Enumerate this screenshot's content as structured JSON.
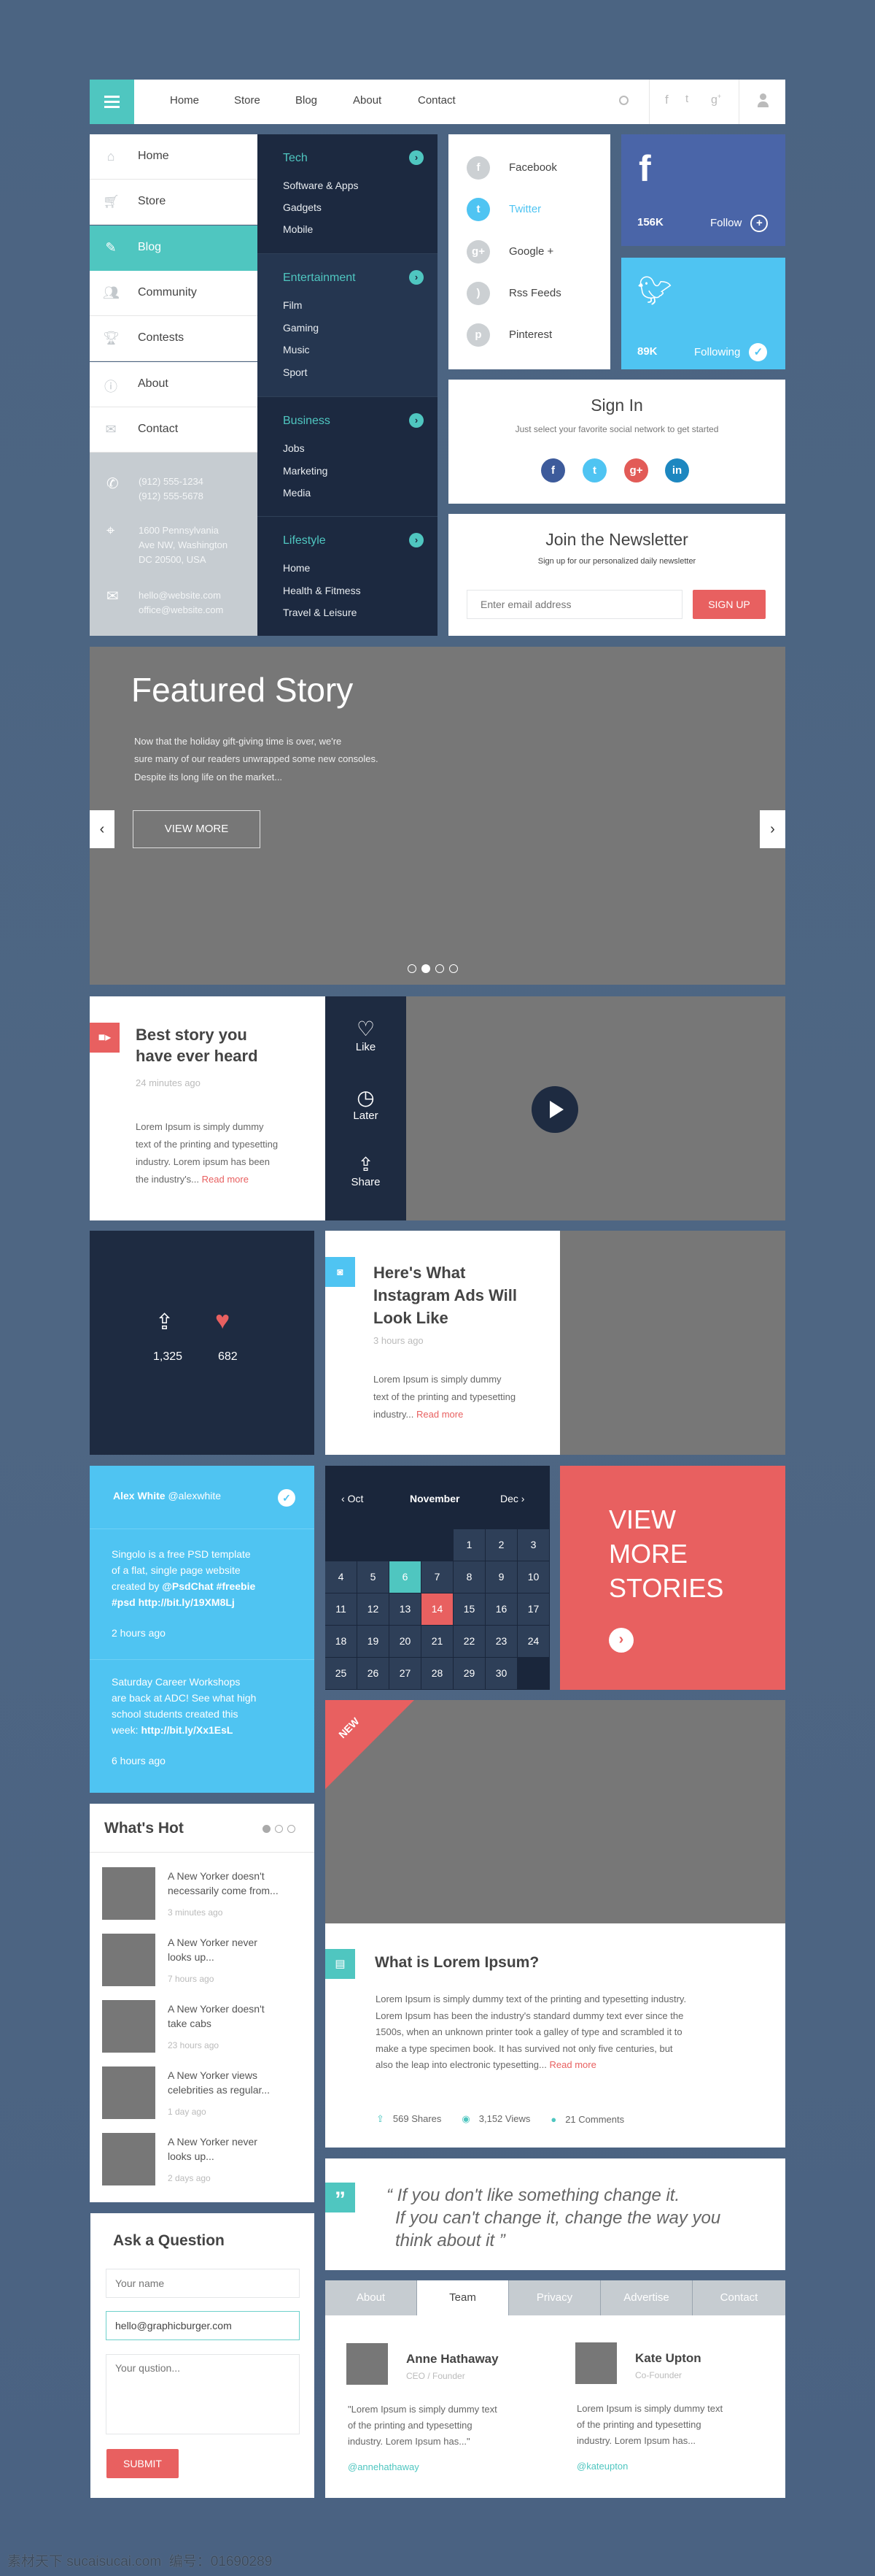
{
  "colors": {
    "teal": "#4fc6c0",
    "dark": "#1e2b41",
    "facebook": "#4a65a8",
    "twitter": "#4fc4f2",
    "red": "#e86060",
    "gray": "#777777"
  },
  "topnav": {
    "menu_icon": "hamburger-icon",
    "items": [
      "Home",
      "Store",
      "Blog",
      "About",
      "Contact"
    ],
    "active": "Blog"
  },
  "sidebar": {
    "items": [
      {
        "label": "Home",
        "icon": "home-icon"
      },
      {
        "label": "Store",
        "icon": "cart-icon"
      },
      {
        "label": "Blog",
        "icon": "edit-icon",
        "active": true
      },
      {
        "label": "Community",
        "icon": "people-icon"
      },
      {
        "label": "Contests",
        "icon": "trophy-icon"
      },
      {
        "label": "About",
        "icon": "info-icon"
      },
      {
        "label": "Contact",
        "icon": "mail-icon"
      }
    ],
    "phone1": "(912) 555-1234",
    "phone2": "(912) 555-5678",
    "address1": "1600 Pennsylvania",
    "address2": "Ave NW, Washington",
    "address3": "DC 20500, USA",
    "email1": "hello@website.com",
    "email2": "office@website.com"
  },
  "megamenu": [
    {
      "title": "Tech",
      "items": [
        "Software & Apps",
        "Gadgets",
        "Mobile"
      ]
    },
    {
      "title": "Entertainment",
      "items": [
        "Film",
        "Gaming",
        "Music",
        "Sport"
      ]
    },
    {
      "title": "Business",
      "items": [
        "Jobs",
        "Marketing",
        "Media"
      ]
    },
    {
      "title": "Lifestyle",
      "items": [
        "Home",
        "Health & Fitmess",
        "Travel & Leisure"
      ]
    }
  ],
  "social_list": [
    "Facebook",
    "Twitter",
    "Google +",
    "Rss Feeds",
    "Pinterest"
  ],
  "facebook_box": {
    "count": "156K",
    "action": "Follow"
  },
  "twitter_box": {
    "count": "89K",
    "action": "Following"
  },
  "signin": {
    "title": "Sign In",
    "subtitle": "Just select your favorite social network to get started"
  },
  "newsletter": {
    "title": "Join the Newsletter",
    "subtitle": "Sign up for our personalized daily newsletter",
    "placeholder": "Enter email address",
    "button": "SIGN UP"
  },
  "featured": {
    "title": "Featured Story",
    "line1": "Now that the holiday gift-giving time is over, we're",
    "line2": "sure many of our readers unwrapped some new consoles.",
    "line3": "Despite its long life on the market...",
    "button": "VIEW MORE",
    "slides": 4,
    "active_slide": 2
  },
  "best_story": {
    "title1": "Best story you",
    "title2": "have ever heard",
    "time": "24 minutes ago",
    "body1": "Lorem Ipsum is simply dummy",
    "body2": "text of the printing and typesetting",
    "body3": "industry. Lorem ipsum has been",
    "body4": "the industry's...",
    "read_more": "Read more",
    "like": "Like",
    "later": "Later",
    "share": "Share"
  },
  "stats": {
    "shares": "1,325",
    "likes": "682"
  },
  "instagram": {
    "title1": "Here's What",
    "title2": "Instagram Ads Will",
    "title3": "Look Like",
    "time": "3 hours ago",
    "body1": "Lorem Ipsum is simply dummy",
    "body2": "text of the printing and typesetting",
    "body3": "industry...",
    "read_more": "Read more"
  },
  "tweets": {
    "name": "Alex White",
    "handle": "@alexwhite",
    "t1a": "Singolo is a free PSD template",
    "t1b": "of a flat, single page website",
    "t1c": "created by ",
    "t1d": "@PsdChat #freebie",
    "t1e": "#psd http://bit.ly/19XM8Lj",
    "t1time": "2 hours ago",
    "t2a": "Saturday Career Workshops",
    "t2b": "are back at ADC! See what high",
    "t2c": "school students created this",
    "t2d": "week: ",
    "t2e": "http://bit.ly/Xx1EsL",
    "t2time": "6 hours ago"
  },
  "calendar": {
    "prev": "Oct",
    "month": "November",
    "next": "Dec",
    "leading_blanks": 4,
    "days": 30,
    "today": 6,
    "selected": 14
  },
  "view_more": {
    "l1": "VIEW",
    "l2": "MORE",
    "l3": "STORIES"
  },
  "whats_hot": {
    "title": "What's Hot",
    "pages": 3,
    "active_page": 1,
    "items": [
      {
        "t1": "A New Yorker doesn't",
        "t2": "necessarily come from...",
        "time": "3 minutes ago"
      },
      {
        "t1": "A New Yorker never",
        "t2": "looks up...",
        "time": "7 hours ago"
      },
      {
        "t1": "A New Yorker doesn't",
        "t2": "take cabs",
        "time": "23 hours ago"
      },
      {
        "t1": "A New Yorker views",
        "t2": "celebrities as regular...",
        "time": "1 day ago"
      },
      {
        "t1": "A New Yorker never",
        "t2": "looks up...",
        "time": "2 days ago"
      }
    ]
  },
  "article": {
    "badge": "NEW",
    "title": "What is Lorem Ipsum?",
    "b1": "Lorem Ipsum is simply dummy text of the printing and typesetting industry.",
    "b2": "Lorem Ipsum has been the industry's standard dummy text ever since the",
    "b3": "1500s, when an unknown printer took a galley of type and scrambled it to",
    "b4": "make a type specimen book. It has survived not only five centuries, but",
    "b5": "also the leap into electronic typesetting...",
    "read_more": "Read more",
    "shares": "569 Shares",
    "views": "3,152 Views",
    "comments": "21 Comments"
  },
  "quote": {
    "l1": "“ If you don't like something change it.",
    "l2": "If you can't change it, change the way you",
    "l3": "think about it ”"
  },
  "ask": {
    "title": "Ask a Question",
    "name_placeholder": "Your name",
    "email_value": "hello@graphicburger.com",
    "question_placeholder": "Your qustion...",
    "submit": "SUBMIT"
  },
  "tabs": {
    "items": [
      "About",
      "Team",
      "Privacy",
      "Advertise",
      "Contact"
    ],
    "active": "Team"
  },
  "team": [
    {
      "name": "Anne Hathaway",
      "role": "CEO / Founder",
      "b1": "\"Lorem Ipsum is simply dummy text",
      "b2": "of the printing and typesetting",
      "b3": "industry. Lorem Ipsum has...\"",
      "handle": "@annehathaway"
    },
    {
      "name": "Kate Upton",
      "role": "Co-Founder",
      "b1": "Lorem Ipsum is simply dummy text",
      "b2": "of the printing and typesetting",
      "b3": "industry. Lorem Ipsum has...",
      "handle": "@kateupton"
    }
  ],
  "watermark": "素材天下 sucaisucai.com  编号：01690289"
}
